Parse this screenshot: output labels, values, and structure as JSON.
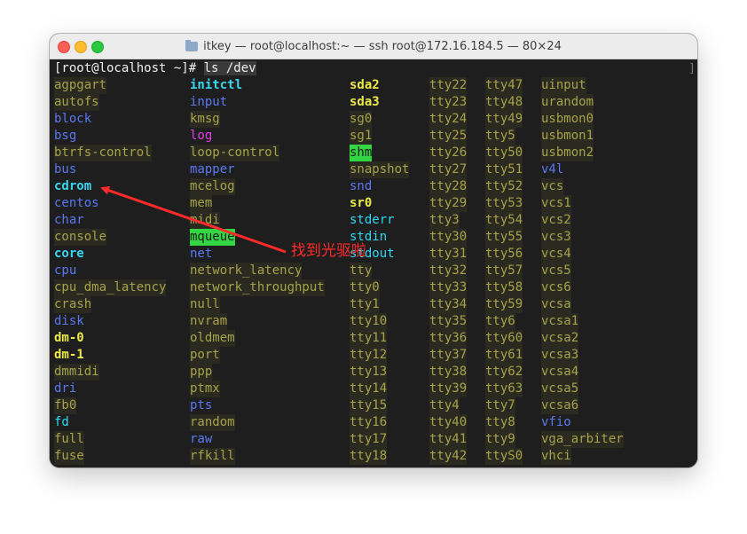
{
  "window": {
    "title": "itkey — root@localhost:~ — ssh root@172.16.184.5 — 80×24"
  },
  "terminal": {
    "prompt": "[root@localhost ~]# ",
    "command": "ls /dev",
    "columns": [
      [
        "agpgart",
        "autofs",
        "block",
        "bsg",
        "btrfs-control",
        "bus",
        "cdrom",
        "centos",
        "char",
        "console",
        "core",
        "cpu",
        "cpu_dma_latency",
        "crash",
        "disk",
        "dm-0",
        "dm-1",
        "dmmidi",
        "dri",
        "fb0",
        "fd",
        "full",
        "fuse"
      ],
      [
        "initctl",
        "input",
        "kmsg",
        "log",
        "loop-control",
        "mapper",
        "mcelog",
        "mem",
        "midi",
        "mqueue",
        "net",
        "network_latency",
        "network_throughput",
        "null",
        "nvram",
        "oldmem",
        "port",
        "ppp",
        "ptmx",
        "pts",
        "random",
        "raw",
        "rfkill"
      ],
      [
        "sda2",
        "sda3",
        "sg0",
        "sg1",
        "shm",
        "snapshot",
        "snd",
        "sr0",
        "stderr",
        "stdin",
        "stdout",
        "tty",
        "tty0",
        "tty1",
        "tty10",
        "tty11",
        "tty12",
        "tty13",
        "tty14",
        "tty15",
        "tty16",
        "tty17",
        "tty18"
      ],
      [
        "tty22",
        "tty23",
        "tty24",
        "tty25",
        "tty26",
        "tty27",
        "tty28",
        "tty29",
        "tty3",
        "tty30",
        "tty31",
        "tty32",
        "tty33",
        "tty34",
        "tty35",
        "tty36",
        "tty37",
        "tty38",
        "tty39",
        "tty4",
        "tty40",
        "tty41",
        "tty42"
      ],
      [
        "tty47",
        "tty48",
        "tty49",
        "tty5",
        "tty50",
        "tty51",
        "tty52",
        "tty53",
        "tty54",
        "tty55",
        "tty56",
        "tty57",
        "tty58",
        "tty59",
        "tty6",
        "tty60",
        "tty61",
        "tty62",
        "tty63",
        "tty7",
        "tty8",
        "tty9",
        "ttyS0"
      ],
      [
        "uinput",
        "urandom",
        "usbmon0",
        "usbmon1",
        "usbmon2",
        "v4l",
        "vcs",
        "vcs1",
        "vcs2",
        "vcs3",
        "vcs4",
        "vcs5",
        "vcs6",
        "vcsa",
        "vcsa1",
        "vcsa2",
        "vcsa3",
        "vcsa4",
        "vcsa5",
        "vcsa6",
        "vfio",
        "vga_arbiter",
        "vhci"
      ]
    ],
    "styles": [
      [
        "f",
        "f",
        "d",
        "d",
        "f",
        "d",
        "c",
        "d",
        "d",
        "f",
        "c",
        "d",
        "f",
        "f",
        "d",
        "b",
        "b",
        "f",
        "d",
        "f",
        "l",
        "f",
        "f"
      ],
      [
        "c",
        "d",
        "f",
        "p",
        "f",
        "d",
        "f",
        "f",
        "f",
        "s",
        "d",
        "f",
        "f",
        "f",
        "f",
        "f",
        "f",
        "f",
        "f",
        "d",
        "f",
        "d",
        "f"
      ],
      [
        "b",
        "b",
        "f",
        "f",
        "s",
        "f",
        "d",
        "b",
        "l",
        "l",
        "l",
        "f",
        "f",
        "f",
        "f",
        "f",
        "f",
        "f",
        "f",
        "f",
        "f",
        "f",
        "f"
      ],
      [
        "f",
        "f",
        "f",
        "f",
        "f",
        "f",
        "f",
        "f",
        "f",
        "f",
        "f",
        "f",
        "f",
        "f",
        "f",
        "f",
        "f",
        "f",
        "f",
        "f",
        "f",
        "f",
        "f"
      ],
      [
        "f",
        "f",
        "f",
        "f",
        "f",
        "f",
        "f",
        "f",
        "f",
        "f",
        "f",
        "f",
        "f",
        "f",
        "f",
        "f",
        "f",
        "f",
        "f",
        "f",
        "f",
        "f",
        "f"
      ],
      [
        "f",
        "f",
        "f",
        "f",
        "f",
        "d",
        "f",
        "f",
        "f",
        "f",
        "f",
        "f",
        "f",
        "f",
        "f",
        "f",
        "f",
        "f",
        "f",
        "f",
        "d",
        "f",
        "f"
      ]
    ]
  },
  "annotation": {
    "text": "找到光驱啦",
    "color": "#ff2a2a"
  },
  "colors": {
    "file": "#a7a34a",
    "directory": "#5b78f0",
    "char_device": "#39d6f0",
    "block_device": "#ecea4a",
    "highlight": "#33d542",
    "pipe": "#e33be8"
  }
}
